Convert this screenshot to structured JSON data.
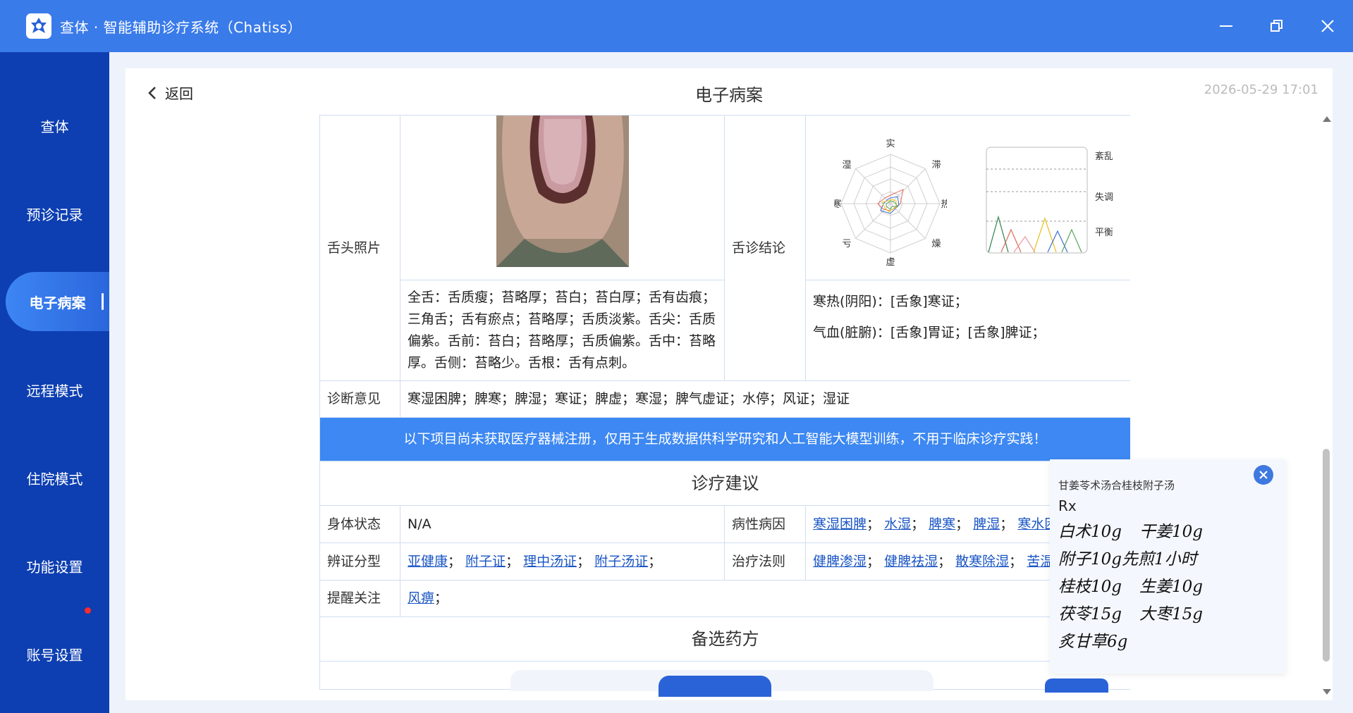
{
  "app": {
    "title": "查体 · 智能辅助诊疗系统（Chatiss）",
    "accent": "#3a7bea",
    "sidebar_color": "#0d3fb2"
  },
  "window": {
    "min_icon": "minimize-icon",
    "restore_icon": "restore-icon",
    "close_icon": "close-icon"
  },
  "sidebar": {
    "items": [
      {
        "label": "查体"
      },
      {
        "label": "预诊记录"
      },
      {
        "label": "电子病案",
        "active": true
      },
      {
        "label": "远程模式"
      },
      {
        "label": "住院模式"
      },
      {
        "label": "功能设置"
      },
      {
        "label": "账号设置",
        "badge": true
      }
    ]
  },
  "header": {
    "back_label": "返回",
    "title": "电子病案",
    "timestamp": "2026-05-29 17:01"
  },
  "record": {
    "tongue_photo_label": "舌头照片",
    "tongue_conclusion_label": "舌诊结论",
    "tongue_description": "全舌：舌质瘦；苔略厚；苔白；苔白厚；舌有齿痕；三角舌；舌有瘀点；苔略厚；舌质淡紫。舌尖：舌质偏紫。舌前：苔白；苔略厚；舌质偏紫。舌中：苔略厚。舌侧：苔略少。舌根：舌有点刺。",
    "conclusion_lines": [
      "寒热(阴阳)：[舌象]寒证；",
      "气血(脏腑)：[舌象]胃证；[舌象]脾证；"
    ],
    "radar_labels": [
      "实",
      "滞",
      "热",
      "燥",
      "虚",
      "亏",
      "寒",
      "湿"
    ],
    "trend_labels": [
      "紊乱",
      "失调",
      "平衡"
    ],
    "diagnosis_label": "诊断意见",
    "diagnosis_text": "寒湿困脾；脾寒；脾湿；寒证；脾虚；寒湿；脾气虚证；水停；风证；湿证"
  },
  "notice": "以下项目尚未获取医疗器械注册，仅用于生成数据供科学研究和人工智能大模型训练，不用于临床诊疗实践！",
  "advice": {
    "section_title": "诊疗建议",
    "body_state_label": "身体状态",
    "body_state_value": "N/A",
    "etiology_label": "病性病因",
    "etiology_links": [
      "寒湿困脾",
      "水湿",
      "脾寒",
      "脾湿",
      "寒水困"
    ],
    "syndrome_label": "辨证分型",
    "syndrome_links": [
      "亚健康",
      "附子证",
      "理中汤证",
      "附子汤证"
    ],
    "therapy_label": "治疗法则",
    "therapy_links": [
      "健脾渗湿",
      "健脾祛湿",
      "散寒除湿",
      "苦温"
    ],
    "reminder_label": "提醒关注",
    "reminder_links": [
      "风痹"
    ],
    "sep": "；"
  },
  "alt_prescription": {
    "section_title": "备选药方"
  },
  "rx_popup": {
    "name": "甘姜苓术汤合桂枝附子汤",
    "rx_label": "Rx",
    "rows": [
      [
        "白术10g",
        "干姜10g"
      ],
      [
        "附子10g先煎1小时"
      ],
      [
        "桂枝10g",
        "生姜10g"
      ],
      [
        "茯苓15g",
        "大枣15g"
      ],
      [
        "炙甘草6g"
      ]
    ]
  }
}
